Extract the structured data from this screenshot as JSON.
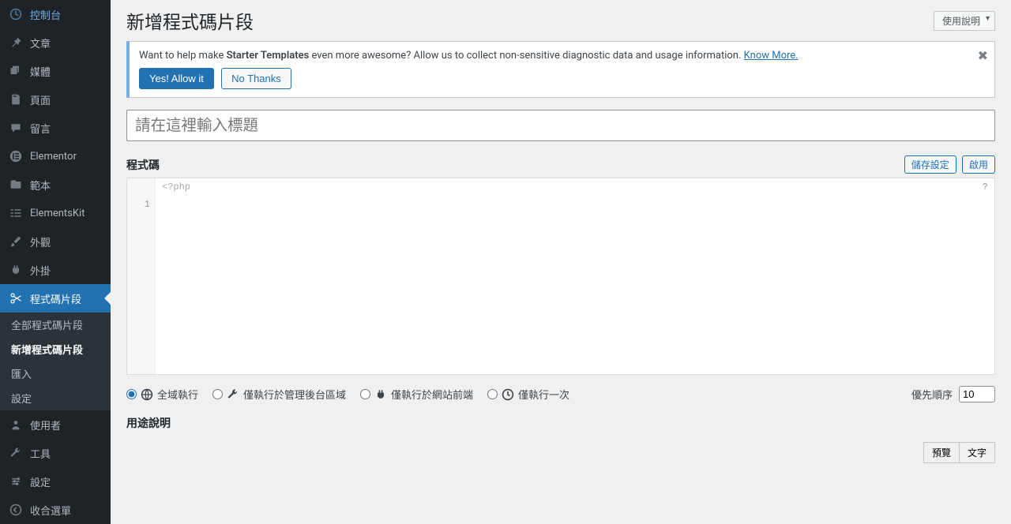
{
  "sidebar": {
    "items": [
      {
        "icon": "dashboard",
        "label": "控制台"
      },
      {
        "icon": "pin",
        "label": "文章"
      },
      {
        "icon": "media",
        "label": "媒體"
      },
      {
        "icon": "page",
        "label": "頁面"
      },
      {
        "icon": "comment",
        "label": "留言"
      },
      {
        "icon": "elementor",
        "label": "Elementor"
      },
      {
        "icon": "folder",
        "label": "範本"
      },
      {
        "icon": "elementskit",
        "label": "ElementsKit"
      },
      {
        "icon": "brush",
        "label": "外觀"
      },
      {
        "icon": "plugin",
        "label": "外掛"
      },
      {
        "icon": "scissors",
        "label": "程式碼片段"
      },
      {
        "icon": "user",
        "label": "使用者"
      },
      {
        "icon": "wrench",
        "label": "工具"
      },
      {
        "icon": "settings",
        "label": "設定"
      },
      {
        "icon": "collapse",
        "label": "收合選單"
      }
    ],
    "activeIndex": 10,
    "submenu": [
      {
        "label": "全部程式碼片段",
        "current": false
      },
      {
        "label": "新增程式碼片段",
        "current": true
      },
      {
        "label": "匯入",
        "current": false
      },
      {
        "label": "設定",
        "current": false
      }
    ]
  },
  "header": {
    "title": "新增程式碼片段",
    "help_btn": "使用說明"
  },
  "notice": {
    "text_before": "Want to help make ",
    "brand": "Starter Templates",
    "text_after": " even more awesome? Allow us to collect non-sensitive diagnostic data and usage information. ",
    "know_more": "Know More.",
    "yes_btn": "Yes! Allow it",
    "no_btn": "No Thanks"
  },
  "title_field": {
    "placeholder": "請在這裡輸入標題",
    "value": ""
  },
  "code_section": {
    "label": "程式碼",
    "save_btn": "儲存設定",
    "activate_btn": "啟用",
    "php_open": "<?php",
    "line_number": "1",
    "help_symbol": "?"
  },
  "scope": {
    "options": [
      {
        "icon": "globe",
        "label": "全域執行",
        "checked": true
      },
      {
        "icon": "wrench",
        "label": "僅執行於管理後台區域",
        "checked": false
      },
      {
        "icon": "plug",
        "label": "僅執行於網站前端",
        "checked": false
      },
      {
        "icon": "clock",
        "label": "僅執行一次",
        "checked": false
      }
    ],
    "priority_label": "優先順序",
    "priority_value": "10"
  },
  "description": {
    "label": "用途說明",
    "tabs": {
      "visual": "預覽",
      "text": "文字"
    }
  }
}
